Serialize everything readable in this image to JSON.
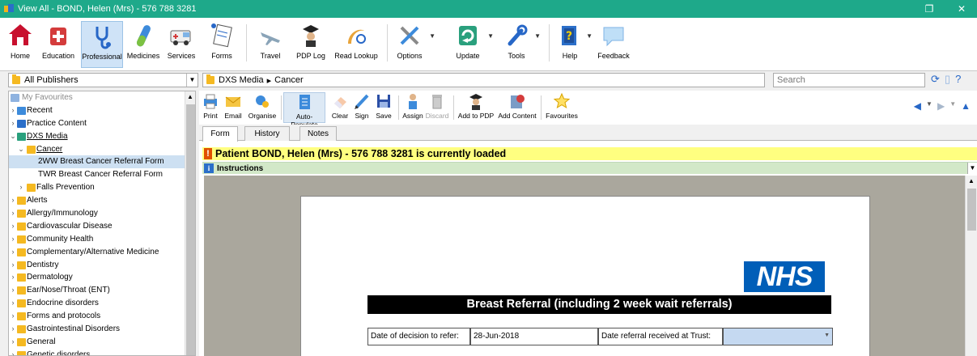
{
  "window": {
    "title": "View All - BOND, Helen (Mrs) - 576 788 3281",
    "restore_glyph": "❐",
    "close_glyph": "✕"
  },
  "ribbon": {
    "items": [
      {
        "label": "Home",
        "icon": "home-icon"
      },
      {
        "label": "Education",
        "icon": "education-icon"
      },
      {
        "label": "Professional",
        "icon": "professional-icon"
      },
      {
        "label": "Medicines",
        "icon": "medicines-icon"
      },
      {
        "label": "Services",
        "icon": "services-icon"
      },
      {
        "label": "Forms",
        "icon": "forms-icon"
      },
      {
        "label": "Travel",
        "icon": "travel-icon"
      },
      {
        "label": "PDP Log",
        "icon": "pdp-log-icon"
      },
      {
        "label": "Read Lookup",
        "icon": "read-lookup-icon"
      },
      {
        "label": "Options",
        "icon": "options-icon"
      },
      {
        "label": "Update",
        "icon": "update-icon"
      },
      {
        "label": "Tools",
        "icon": "tools-icon"
      },
      {
        "label": "Help",
        "icon": "help-icon"
      },
      {
        "label": "Feedback",
        "icon": "feedback-icon"
      }
    ],
    "active": "Professional"
  },
  "addressbar": {
    "publisher": "All Publishers",
    "crumb_root": "DXS Media",
    "crumb_sep": "▸",
    "crumb_leaf": "Cancer",
    "search_placeholder": "Search"
  },
  "sidebar": {
    "items": [
      {
        "label": "My Favourites",
        "muted": true
      },
      {
        "label": "Recent"
      },
      {
        "label": "Practice Content"
      },
      {
        "label": "DXS Media",
        "link": true
      },
      {
        "label": "Cancer",
        "link": true
      },
      {
        "label": "2WW Breast Cancer Referral Form",
        "selected": true
      },
      {
        "label": "TWR Breast Cancer Referral Form"
      },
      {
        "label": "Falls Prevention"
      },
      {
        "label": "Alerts"
      },
      {
        "label": "Allergy/Immunology"
      },
      {
        "label": "Cardiovascular Disease"
      },
      {
        "label": "Community Health"
      },
      {
        "label": "Complementary/Alternative Medicine"
      },
      {
        "label": "Dentistry"
      },
      {
        "label": "Dermatology"
      },
      {
        "label": "Ear/Nose/Throat (ENT)"
      },
      {
        "label": "Endocrine disorders"
      },
      {
        "label": "Forms and protocols"
      },
      {
        "label": "Gastrointestinal Disorders"
      },
      {
        "label": "General"
      },
      {
        "label": "Genetic disorders"
      }
    ]
  },
  "toolbar": {
    "items": [
      {
        "label": "Print",
        "icon": "print-icon"
      },
      {
        "label": "Email",
        "icon": "email-icon"
      },
      {
        "label": "Organise",
        "icon": "organise-icon"
      },
      {
        "label": "Auto-Populate",
        "icon": "auto-populate-icon"
      },
      {
        "label": "Clear",
        "icon": "clear-icon"
      },
      {
        "label": "Sign",
        "icon": "sign-icon"
      },
      {
        "label": "Save",
        "icon": "save-icon"
      },
      {
        "label": "Assign",
        "icon": "assign-icon"
      },
      {
        "label": "Discard",
        "icon": "discard-icon"
      },
      {
        "label": "Add to PDP",
        "icon": "add-to-pdp-icon"
      },
      {
        "label": "Add Content",
        "icon": "add-content-icon"
      },
      {
        "label": "Favourites",
        "icon": "favourites-icon"
      }
    ]
  },
  "tabs": [
    {
      "label": "Form"
    },
    {
      "label": "History"
    },
    {
      "label": "Notes"
    }
  ],
  "patient_banner": "Patient BOND, Helen (Mrs) - 576 788 3281 is currently loaded",
  "instructions_label": "Instructions",
  "document": {
    "logo_text": "NHS",
    "title": "Breast Referral (including 2 week wait referrals)",
    "decision_label": "Date of decision to refer:",
    "decision_value": "28-Jun-2018",
    "received_label": "Date referral received at Trust:",
    "received_value": ""
  },
  "colors": {
    "titlebar": "#1ea98a",
    "patient_banner": "#ffff80",
    "instructions_bar": "#d2e8c8",
    "nhs_blue": "#005eb8",
    "folder": "#f5b921",
    "selected_row": "#cde0f2"
  }
}
